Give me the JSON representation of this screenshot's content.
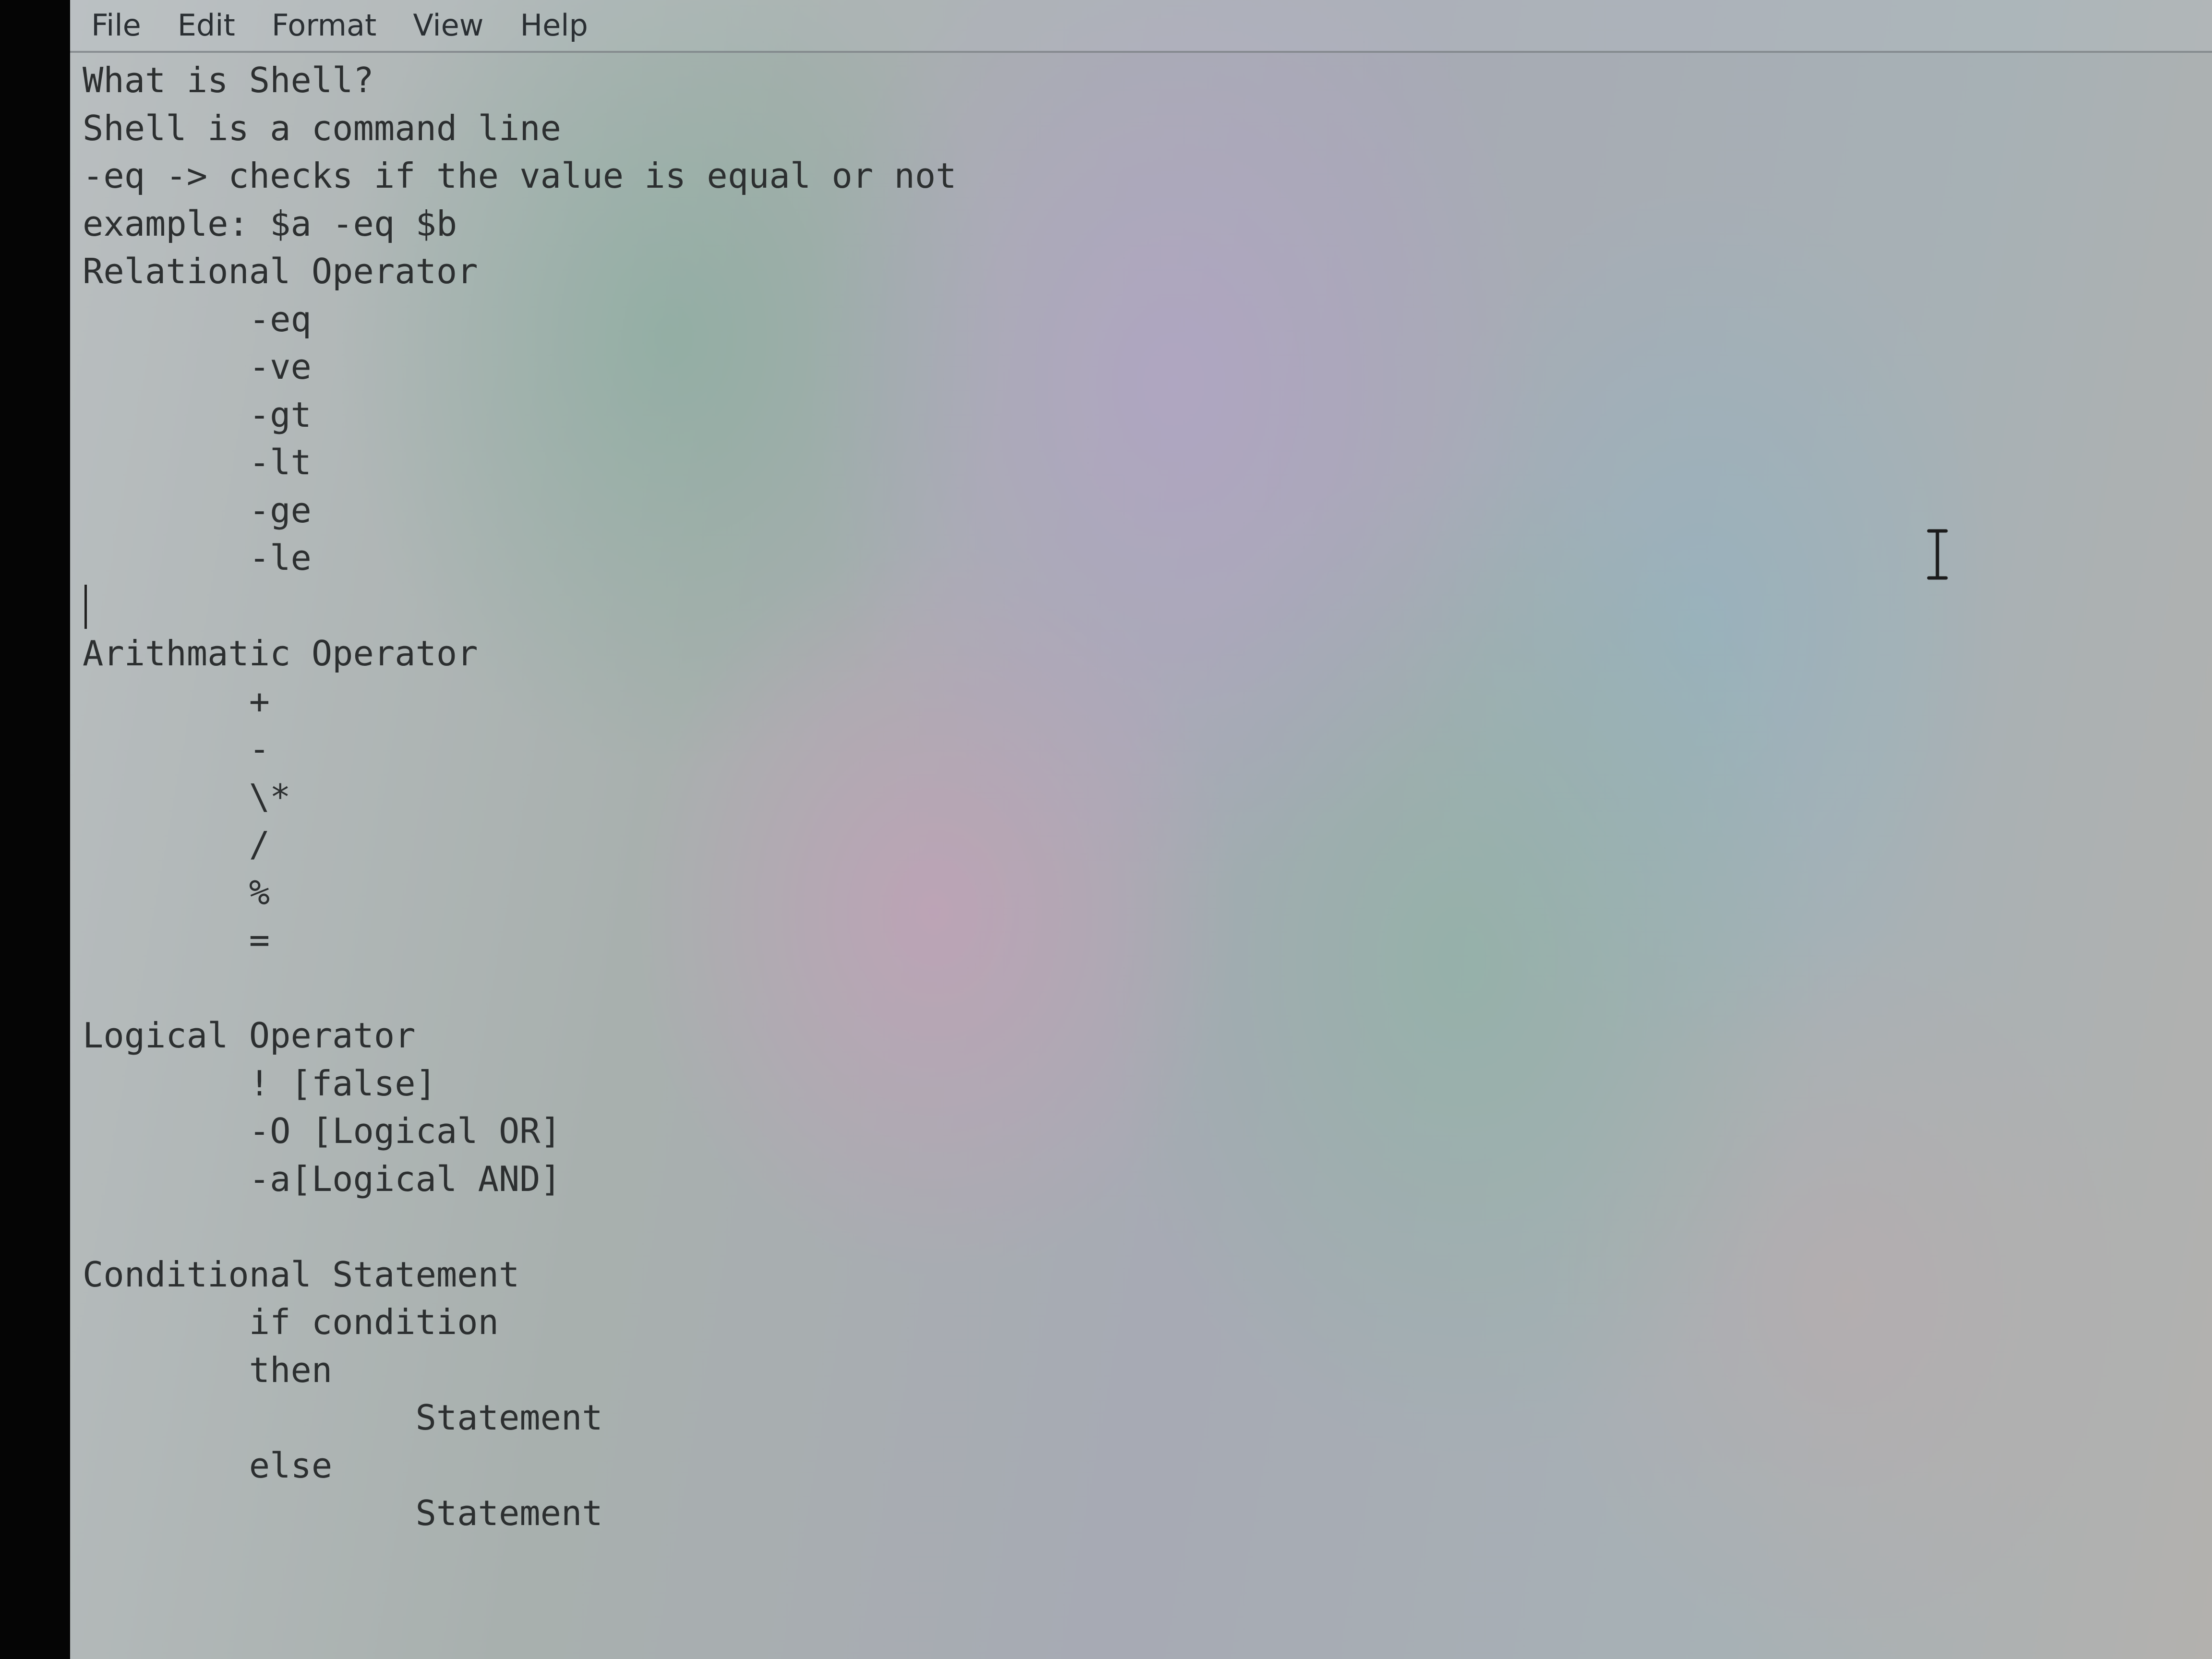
{
  "menubar": {
    "items": [
      "File",
      "Edit",
      "Format",
      "View",
      "Help"
    ]
  },
  "editor": {
    "lines": [
      "What is Shell?",
      "Shell is a command line",
      "-eq -> checks if the value is equal or not",
      "example: $a -eq $b",
      "Relational Operator",
      "        -eq",
      "        -ve",
      "        -gt",
      "        -lt",
      "        -ge",
      "        -le",
      "",
      "Arithmatic Operator",
      "        +",
      "        -",
      "        \\*",
      "        /",
      "        %",
      "        =",
      "",
      "Logical Operator",
      "        ! [false]",
      "        -O [Logical OR]",
      "        -a[Logical AND]",
      "",
      "Conditional Statement",
      "        if condition",
      "        then",
      "                Statement",
      "        else",
      "                Statement"
    ]
  },
  "icons": {
    "text_cursor": "i-beam-cursor-icon"
  }
}
